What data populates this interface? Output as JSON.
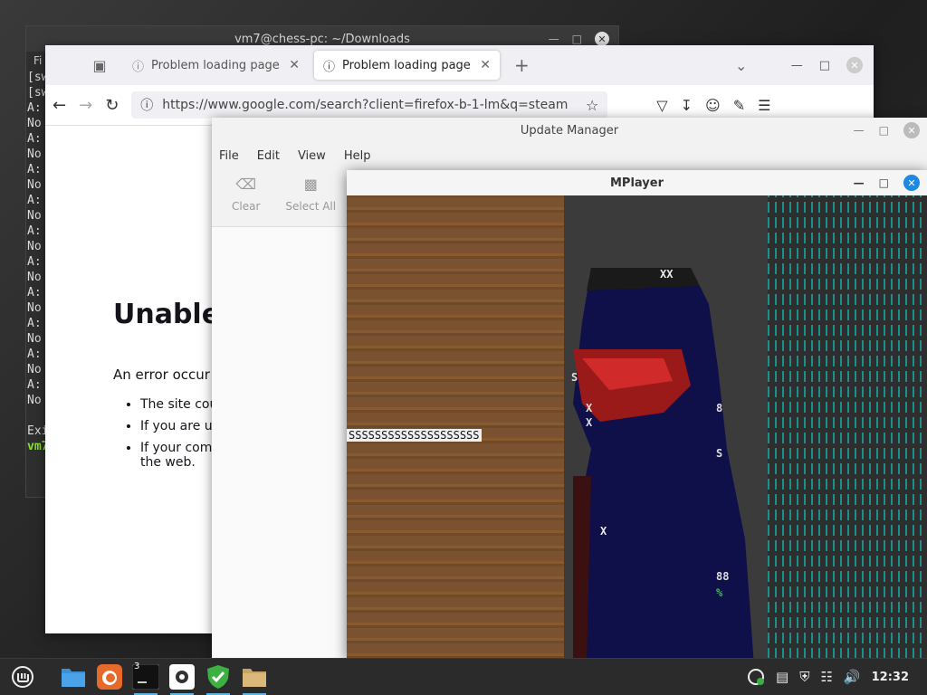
{
  "terminal": {
    "title": "vm7@chess-pc: ~/Downloads",
    "menu_fragment": "Fi",
    "lines": [
      "[sw",
      "[sw",
      "A:",
      "No",
      "A:",
      "No",
      "A:",
      "No",
      "A:",
      "No",
      "A:",
      "No",
      "A:",
      "No",
      "A:",
      "No",
      "A:",
      "No",
      "A:",
      "No",
      "A:",
      "No",
      "",
      "Exi"
    ],
    "prompt": "vm7"
  },
  "firefox": {
    "tabs": [
      {
        "label": "Problem loading page",
        "active": false
      },
      {
        "label": "Problem loading page",
        "active": true
      }
    ],
    "url": "https://www.google.com/search?client=firefox-b-1-lm&q=steam",
    "error": {
      "heading": "Unable",
      "intro": "An error occur",
      "bullets": [
        "The site cou",
        "If you are ur",
        "If your comp"
      ],
      "bullet_tail": "the web."
    }
  },
  "update_manager": {
    "title": "Update Manager",
    "menu": [
      "File",
      "Edit",
      "View",
      "Help"
    ],
    "tools": [
      {
        "label": "Clear",
        "icon": "clear-icon"
      },
      {
        "label": "Select All",
        "icon": "select-all-icon"
      }
    ]
  },
  "mplayer": {
    "title": "MPlayer",
    "ascii_line": "SSSSSSSSSSSSSSSSSSSS",
    "fig_chars": [
      "XX",
      "X:",
      "XX",
      "X",
      "X",
      "S",
      "X",
      "S",
      "X",
      "8",
      "X",
      "X",
      "88",
      "%",
      "8"
    ]
  },
  "taskbar": {
    "terminal_badge": "3",
    "clock": "12:32"
  }
}
